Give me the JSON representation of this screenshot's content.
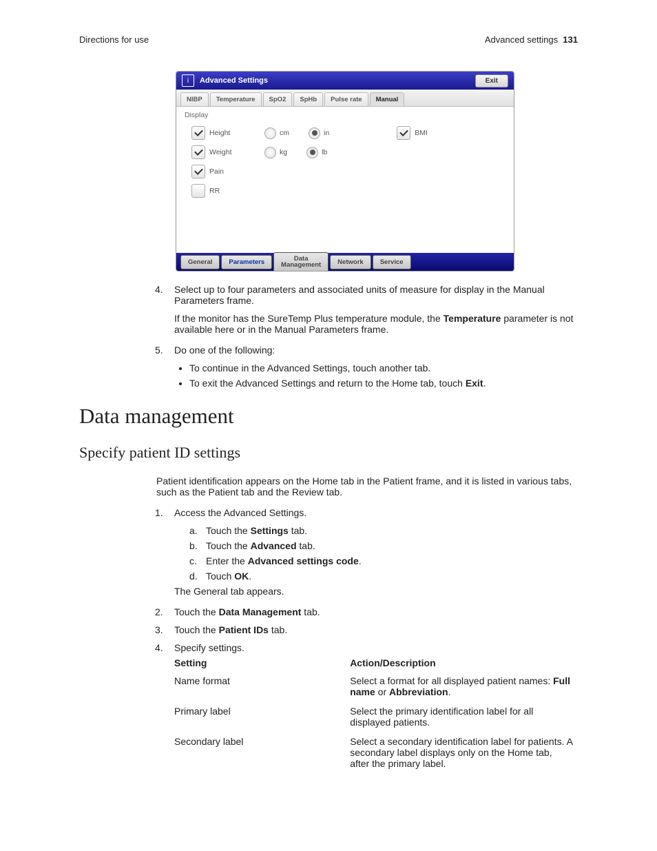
{
  "header": {
    "left": "Directions for use",
    "right_label": "Advanced settings",
    "page_no": "131"
  },
  "screenshot": {
    "title": "Advanced Settings",
    "exit": "Exit",
    "tabs": [
      "NIBP",
      "Temperature",
      "SpO2",
      "SpHb",
      "Pulse rate",
      "Manual"
    ],
    "active_tab": "Manual",
    "section": "Display",
    "rows": {
      "height": {
        "label": "Height",
        "checked": true,
        "opts": [
          "cm",
          "in"
        ],
        "sel": "in",
        "extra_label": "BMI",
        "extra_checked": true
      },
      "weight": {
        "label": "Weight",
        "checked": true,
        "opts": [
          "kg",
          "lb"
        ],
        "sel": "lb"
      },
      "pain": {
        "label": "Pain",
        "checked": true
      },
      "rr": {
        "label": "RR",
        "checked": false
      }
    },
    "footer_tabs": [
      "General",
      "Parameters",
      "Data\nManagement",
      "Network",
      "Service"
    ],
    "footer_active": "Parameters"
  },
  "step4": {
    "num": "4.",
    "text": "Select up to four parameters and associated units of measure for display in the Manual Parameters frame.",
    "note_a": "If the monitor has the SureTemp Plus temperature module, the ",
    "note_bold": "Temperature",
    "note_b": " parameter is not available here or in the Manual Parameters frame."
  },
  "step5": {
    "num": "5.",
    "text": "Do one of the following:",
    "b1": "To continue in the Advanced Settings, touch another tab.",
    "b2a": "To exit the Advanced Settings and return to the Home tab, touch ",
    "b2b": "Exit",
    "b2c": "."
  },
  "h1": "Data management",
  "h2": "Specify patient ID settings",
  "intro": "Patient identification appears on the Home tab in the Patient frame, and it is listed in various tabs, such as the Patient tab and the Review tab.",
  "s1": {
    "num": "1.",
    "text": "Access the Advanced Settings.",
    "a": {
      "l": "a.",
      "t1": "Touch the ",
      "b": "Settings",
      "t2": " tab."
    },
    "b": {
      "l": "b.",
      "t1": "Touch the ",
      "b": "Advanced",
      "t2": " tab."
    },
    "c": {
      "l": "c.",
      "t1": "Enter the ",
      "b": "Advanced settings code",
      "t2": "."
    },
    "d": {
      "l": "d.",
      "t1": "Touch ",
      "b": "OK",
      "t2": "."
    },
    "tail": "The General tab appears."
  },
  "s2": {
    "num": "2.",
    "t1": "Touch the ",
    "b": "Data Management",
    "t2": " tab."
  },
  "s3": {
    "num": "3.",
    "t1": "Touch the ",
    "b": "Patient IDs",
    "t2": " tab."
  },
  "s4": {
    "num": "4.",
    "text": "Specify settings."
  },
  "table": {
    "h1": "Setting",
    "h2": "Action/Description",
    "r1": {
      "s": "Name format",
      "d1": "Select a format for all displayed patient names: ",
      "b1": "Full name",
      "d2": " or ",
      "b2": "Abbreviation",
      "d3": "."
    },
    "r2": {
      "s": "Primary label",
      "d": "Select the primary identification label for all displayed patients."
    },
    "r3": {
      "s": "Secondary label",
      "d": "Select a secondary identification label for patients. A secondary label displays only on the Home tab, after the primary label."
    }
  }
}
